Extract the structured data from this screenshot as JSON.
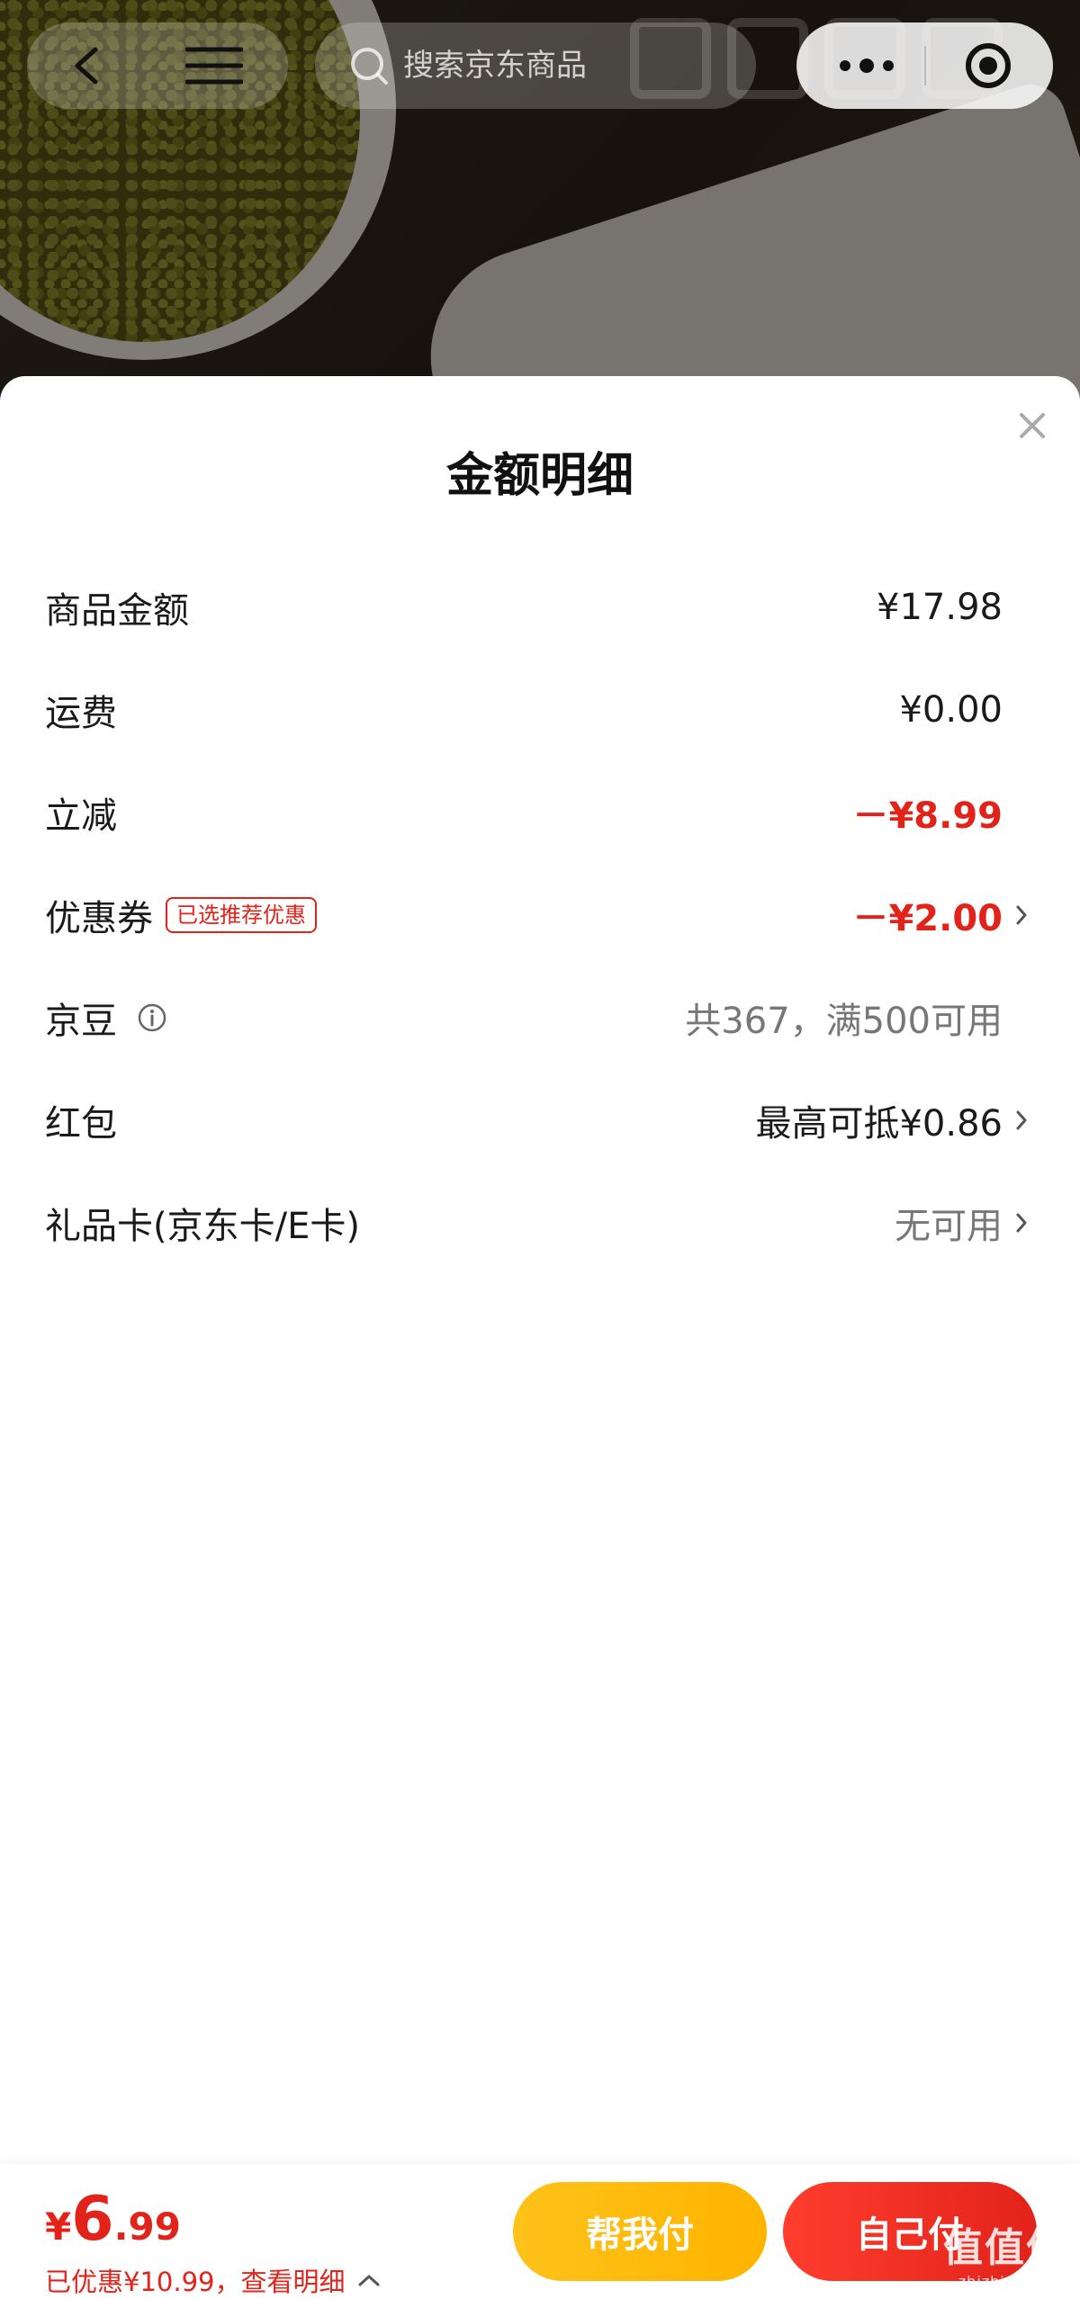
{
  "nav": {
    "search_placeholder": "搜索京东商品",
    "back_icon": "back-arrow-icon",
    "menu_icon": "hamburger-menu-icon",
    "more_icon": "more-dots-icon",
    "close_icon": "target-close-icon"
  },
  "sheet": {
    "title": "金额明细",
    "rows": [
      {
        "label": "商品金额",
        "value": "¥17.98"
      },
      {
        "label": "运费",
        "value": "¥0.00"
      },
      {
        "label": "立减",
        "value": "－¥8.99"
      },
      {
        "label": "优惠券",
        "badge": "已选推荐优惠",
        "value": "－¥2.00"
      },
      {
        "label": "京豆",
        "value": "共367，满500可用"
      },
      {
        "label": "红包",
        "value": "最高可抵¥0.86"
      },
      {
        "label": "礼品卡(京东卡/E卡)",
        "value": "无可用"
      }
    ]
  },
  "footer": {
    "currency": "¥",
    "price_int": "6",
    "price_dec": ".99",
    "saved_text": "已优惠¥10.99，查看明细",
    "help_pay_label": "帮我付",
    "self_pay_label": "自己付",
    "watermark": "值值值",
    "watermark_sub": "zhizhizhi.com"
  },
  "colors": {
    "accent_red": "#e2231a",
    "accent_yellow": "#ffb400"
  }
}
